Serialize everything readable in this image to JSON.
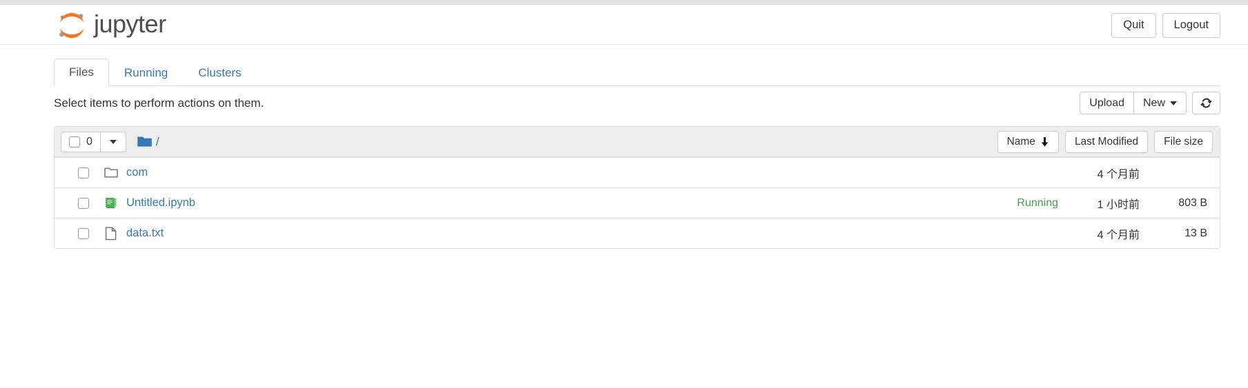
{
  "header": {
    "brand_text": "jupyter",
    "logo_icon": "jupyter-logo",
    "buttons": [
      {
        "label": "Quit",
        "name": "quit-button"
      },
      {
        "label": "Logout",
        "name": "logout-button"
      }
    ]
  },
  "tabs": [
    {
      "label": "Files",
      "active": true
    },
    {
      "label": "Running",
      "active": false
    },
    {
      "label": "Clusters",
      "active": false
    }
  ],
  "toolbar": {
    "note": "Select items to perform actions on them.",
    "upload_label": "Upload",
    "new_label": "New",
    "new_caret_icon": "chevron-down-icon",
    "refresh_icon": "refresh-icon"
  },
  "list_header": {
    "select_count": "0",
    "select_checkbox_icon": "checkbox-icon",
    "select_caret_icon": "chevron-down-icon",
    "breadcrumb_folder_icon": "folder-filled-icon",
    "breadcrumb_path": "/",
    "sort_name": "Name",
    "sort_name_arrow_icon": "arrow-down-icon",
    "sort_last_modified": "Last Modified",
    "sort_file_size": "File size"
  },
  "files": [
    {
      "name": "com",
      "icon": "folder-outline-icon",
      "status": "",
      "last_modified": "4 个月前",
      "size": ""
    },
    {
      "name": "Untitled.ipynb",
      "icon": "notebook-icon",
      "status": "Running",
      "last_modified": "1 小时前",
      "size": "803 B"
    },
    {
      "name": "data.txt",
      "icon": "file-icon",
      "status": "",
      "last_modified": "4 个月前",
      "size": "13 B"
    }
  ],
  "colors": {
    "link": "#337ab7",
    "running": "#44a047",
    "logo_orange": "#f37726",
    "logo_gray": "#9e9e9e",
    "folder_blue": "#337ab7",
    "notebook_green": "#4caf50"
  }
}
